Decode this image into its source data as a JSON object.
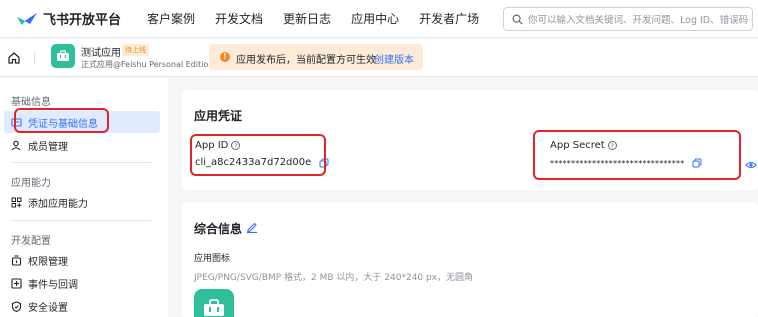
{
  "topnav": {
    "brand": "飞书开放平台",
    "links": [
      "客户案例",
      "开发文档",
      "更新日志",
      "应用中心",
      "开发者广场"
    ],
    "search_placeholder": "你可以输入文档关键词、开发问题、Log ID、错误码"
  },
  "appbar": {
    "app_name": "测试应用",
    "badge": "待上线",
    "app_edition": "正式应用@Feishu Personal Edition",
    "notice_text": "应用发布后，当前配置方可生效",
    "notice_link": "创建版本"
  },
  "sidebar": {
    "sections": [
      {
        "title": "基础信息",
        "items": [
          {
            "label": "凭证与基础信息",
            "icon": "credential-icon",
            "active": true
          },
          {
            "label": "成员管理",
            "icon": "member-icon"
          }
        ]
      },
      {
        "title": "应用能力",
        "items": [
          {
            "label": "添加应用能力",
            "icon": "add-capability-icon"
          }
        ]
      },
      {
        "title": "开发配置",
        "items": [
          {
            "label": "权限管理",
            "icon": "permission-icon"
          },
          {
            "label": "事件与回调",
            "icon": "event-icon"
          },
          {
            "label": "安全设置",
            "icon": "shield-icon"
          }
        ]
      }
    ]
  },
  "credentials": {
    "title": "应用凭证",
    "app_id_label": "App ID",
    "app_id_value": "cli_a8c2433a7d72d00e",
    "app_secret_label": "App Secret",
    "app_secret_value": "********************************"
  },
  "general": {
    "title": "综合信息",
    "icon_label": "应用图标",
    "icon_hint": "JPEG/PNG/SVG/BMP 格式，2 MB 以内，大于 240*240 px，无圆角"
  },
  "colors": {
    "accent": "#3370ff",
    "highlight": "#e2232a",
    "app_green": "#2fc09b",
    "warning": "#f08a24"
  }
}
